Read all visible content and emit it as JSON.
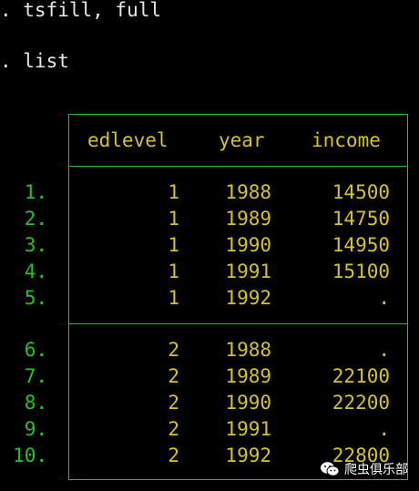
{
  "console": {
    "commands": [
      ". tsfill, full",
      ". list"
    ]
  },
  "table": {
    "headers": [
      "edlevel",
      "year",
      "income"
    ],
    "groups": [
      [
        {
          "n": "1.",
          "edlevel": "1",
          "year": "1988",
          "income": "14500"
        },
        {
          "n": "2.",
          "edlevel": "1",
          "year": "1989",
          "income": "14750"
        },
        {
          "n": "3.",
          "edlevel": "1",
          "year": "1990",
          "income": "14950"
        },
        {
          "n": "4.",
          "edlevel": "1",
          "year": "1991",
          "income": "15100"
        },
        {
          "n": "5.",
          "edlevel": "1",
          "year": "1992",
          "income": "."
        }
      ],
      [
        {
          "n": "6.",
          "edlevel": "2",
          "year": "1988",
          "income": "."
        },
        {
          "n": "7.",
          "edlevel": "2",
          "year": "1989",
          "income": "22100"
        },
        {
          "n": "8.",
          "edlevel": "2",
          "year": "1990",
          "income": "22200"
        },
        {
          "n": "9.",
          "edlevel": "2",
          "year": "1991",
          "income": "."
        },
        {
          "n": "10.",
          "edlevel": "2",
          "year": "1992",
          "income": "22800"
        }
      ]
    ]
  },
  "watermark": {
    "icon": "wechat-icon",
    "text": "爬虫俱乐部"
  },
  "colors": {
    "background": "#000000",
    "command_text": "#e6e6e6",
    "table_border": "#22c322",
    "row_number": "#22c322",
    "data_text": "#d4c41c"
  }
}
